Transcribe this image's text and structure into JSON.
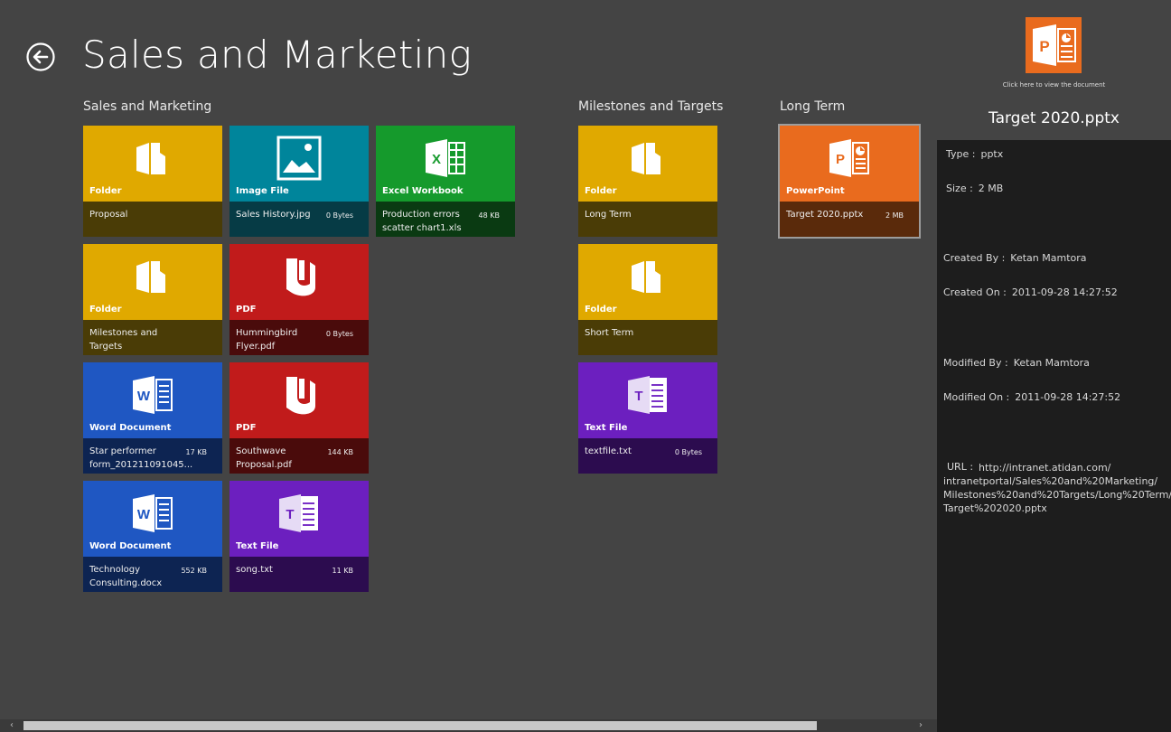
{
  "header": {
    "title": "Sales and Marketing"
  },
  "groups": [
    {
      "title": "Sales and Marketing"
    },
    {
      "title": "Milestones and Targets"
    },
    {
      "title": "Long Term"
    }
  ],
  "tiles": [
    {
      "type": "Folder",
      "name": "Proposal",
      "size": "",
      "icon": "folder-icon",
      "color": "#e0a900",
      "dark": "#4a3c06"
    },
    {
      "type": "Image File",
      "name": "Sales History.jpg",
      "size": "0 Bytes",
      "icon": "image-icon",
      "color": "#00859b",
      "dark": "#063b45"
    },
    {
      "type": "Excel Workbook",
      "name": "Production errors scatter chart1.xls",
      "size": "48 KB",
      "icon": "excel-icon",
      "color": "#159a2c",
      "dark": "#0a3a12"
    },
    {
      "type": "Folder",
      "name": "Milestones and Targets",
      "size": "",
      "icon": "folder-icon",
      "color": "#e0a900",
      "dark": "#4a3c06"
    },
    {
      "type": "PDF",
      "name": "Hummingbird Flyer.pdf",
      "size": "0 Bytes",
      "icon": "pdf-icon",
      "color": "#c11b1b",
      "dark": "#4a0b0b"
    },
    {
      "type": "Word Document",
      "name": "Star performer form_201211091045...",
      "size": "17 KB",
      "icon": "word-icon",
      "color": "#1f57c2",
      "dark": "#0d2452"
    },
    {
      "type": "PDF",
      "name": "Southwave Proposal.pdf",
      "size": "144 KB",
      "icon": "pdf-icon",
      "color": "#c11b1b",
      "dark": "#4a0b0b"
    },
    {
      "type": "Word Document",
      "name": "Technology Consulting.docx",
      "size": "552 KB",
      "icon": "word-icon",
      "color": "#1f57c2",
      "dark": "#0d2452"
    },
    {
      "type": "Text File",
      "name": "song.txt",
      "size": "11 KB",
      "icon": "text-file-icon",
      "color": "#6c1fbf",
      "dark": "#2c0c4f"
    },
    {
      "type": "Folder",
      "name": "Long Term",
      "size": "",
      "icon": "folder-icon",
      "color": "#e0a900",
      "dark": "#4a3c06"
    },
    {
      "type": "Folder",
      "name": "Short Term",
      "size": "",
      "icon": "folder-icon",
      "color": "#e0a900",
      "dark": "#4a3c06"
    },
    {
      "type": "Text File",
      "name": "textfile.txt",
      "size": "0 Bytes",
      "icon": "text-file-icon",
      "color": "#6c1fbf",
      "dark": "#2c0c4f"
    },
    {
      "type": "PowerPoint",
      "name": "Target 2020.pptx",
      "size": "2 MB",
      "icon": "powerpoint-icon",
      "color": "#e96b1e",
      "dark": "#5a2a0b"
    }
  ],
  "details": {
    "view_hint": "Click here to view the document",
    "title": "Target 2020.pptx",
    "type_label": "Type :",
    "type_value": "pptx",
    "size_label": "Size :",
    "size_value": "2 MB",
    "created_by_label": "Created By :",
    "created_by_value": "Ketan Mamtora",
    "created_on_label": "Created On :",
    "created_on_value": "2011-09-28 14:27:52",
    "modified_by_label": "Modified By :",
    "modified_by_value": "Ketan Mamtora",
    "modified_on_label": "Modified On :",
    "modified_on_value": "2011-09-28 14:27:52",
    "url_label": "URL :",
    "url_value": "http://intranet.atidan.com/ intranetportal/Sales%20and%20Marketing/ Milestones%20and%20Targets/Long%20Term/ Target%202020.pptx"
  },
  "scrollbar": {
    "left_arrow": "‹",
    "right_arrow": "›"
  }
}
